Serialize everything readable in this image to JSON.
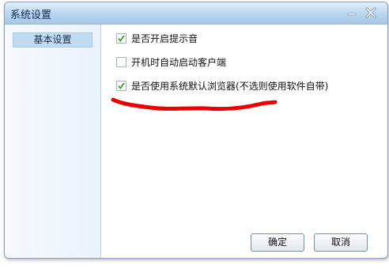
{
  "window": {
    "title": "系统设置"
  },
  "icons": {
    "minimize": "minimize-icon",
    "close": "close-icon",
    "check": "checkmark-icon"
  },
  "sidebar": {
    "items": [
      {
        "label": "基本设置",
        "selected": true
      }
    ]
  },
  "options": [
    {
      "label": "是否开启提示音",
      "checked": true
    },
    {
      "label": "开机时自动启动客户端",
      "checked": false
    },
    {
      "label": "是否使用系统默认浏览器(不选则使用软件自带)",
      "checked": true
    }
  ],
  "buttons": {
    "ok": "确定",
    "cancel": "取消"
  },
  "colors": {
    "annotation": "#ee0000",
    "accent": "#c1dbf3",
    "check": "#3d9a2e"
  }
}
